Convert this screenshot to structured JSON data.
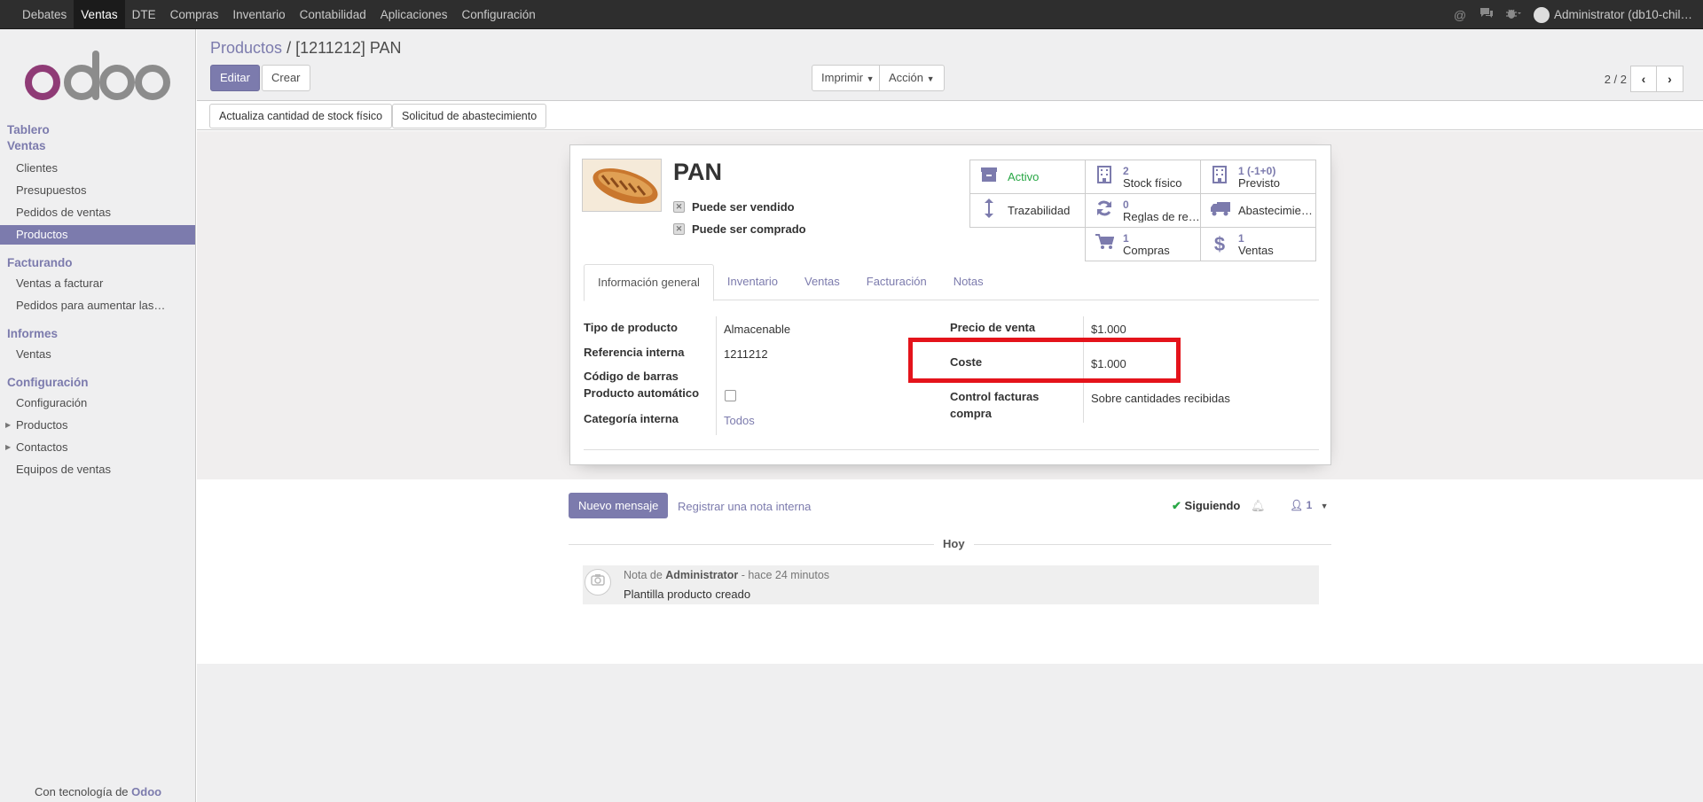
{
  "topbar": {
    "menu": [
      "Debates",
      "Ventas",
      "DTE",
      "Compras",
      "Inventario",
      "Contabilidad",
      "Aplicaciones",
      "Configuración"
    ],
    "active": "Ventas",
    "user": "Administrator (db10-chil…"
  },
  "sidebar": {
    "sections": {
      "tablero": "Tablero",
      "ventas": "Ventas",
      "facturando": "Facturando",
      "informes": "Informes",
      "configuracion": "Configuración"
    },
    "items": {
      "clientes": "Clientes",
      "presupuestos": "Presupuestos",
      "pedidos_ventas": "Pedidos de ventas",
      "productos": "Productos",
      "ventas_facturar": "Ventas a facturar",
      "pedidos_aumentar": "Pedidos para aumentar las…",
      "informes_ventas": "Ventas",
      "config_configuracion": "Configuración",
      "config_productos": "Productos",
      "config_contactos": "Contactos",
      "config_equipos": "Equipos de ventas"
    },
    "powered_prefix": "Con tecnología de",
    "powered_brand": "Odoo",
    "logo_text": "odoo"
  },
  "control": {
    "breadcrumb_parent": "Productos",
    "breadcrumb_sep": "/",
    "breadcrumb_current": "[1211212] PAN",
    "edit": "Editar",
    "create": "Crear",
    "print": "Imprimir",
    "action": "Acción",
    "pager": "2 / 2"
  },
  "statusbar": {
    "update_stock": "Actualiza cantidad de stock físico",
    "procurement": "Solicitud de abastecimiento"
  },
  "product": {
    "name": "PAN",
    "can_sell": "Puede ser vendido",
    "can_buy": "Puede ser comprado"
  },
  "buttonbox": {
    "active": "Activo",
    "stock_num": "2",
    "stock_label": "Stock físico",
    "forecast_num": "1 (-1+0)",
    "forecast_label": "Previsto",
    "traceability": "Trazabilidad",
    "rules_num": "0",
    "rules_label": "Reglas de re…",
    "procurements": "Abastecimientos",
    "purchases_num": "1",
    "purchases_label": "Compras",
    "sales_num": "1",
    "sales_label": "Ventas"
  },
  "tabs": [
    "Información general",
    "Inventario",
    "Ventas",
    "Facturación",
    "Notas"
  ],
  "fields": {
    "tipo_label": "Tipo de producto",
    "tipo_value": "Almacenable",
    "ref_label": "Referencia interna",
    "ref_value": "1211212",
    "barcode_label": "Código de barras",
    "auto_label": "Producto automático",
    "categ_label": "Categoría interna",
    "categ_value": "Todos",
    "precio_label": "Precio de venta",
    "precio_value": "$1.000",
    "coste_label": "Coste",
    "coste_value": "$1.000",
    "control_label_1": "Control facturas",
    "control_label_2": "compra",
    "control_value": "Sobre cantidades recibidas"
  },
  "chatter": {
    "new_message": "Nuevo mensaje",
    "log_note": "Registrar una nota interna",
    "following": "Siguiendo",
    "followers": "1",
    "day": "Hoy",
    "note_prefix": "Nota de",
    "note_author": "Administrator",
    "note_time": "- hace 24 minutos",
    "note_body": "Plantilla producto creado"
  },
  "colors": {
    "brand": "#7c7bad",
    "highlight": "#e4131b",
    "active_status": "#28a745"
  }
}
